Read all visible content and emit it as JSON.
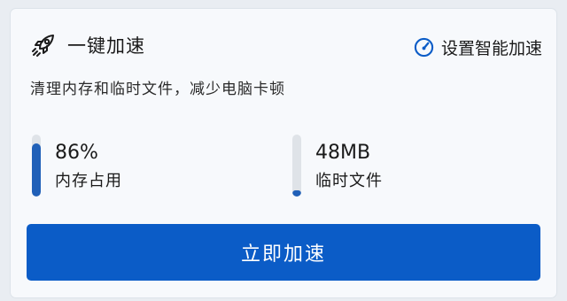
{
  "header": {
    "title": "一键加速",
    "icon": "rocket-icon",
    "settings_label": "设置智能加速",
    "settings_icon": "speedometer-icon"
  },
  "subtitle": "清理内存和临时文件，减少电脑卡顿",
  "metrics": [
    {
      "value": "86%",
      "label": "内存占用",
      "level": 0.86
    },
    {
      "value": "48MB",
      "label": "临时文件",
      "level": 0.1
    }
  ],
  "action_button": {
    "label": "立即加速"
  },
  "colors": {
    "accent": "#0b5cc7",
    "bar_fill": "#2060b8",
    "bar_track": "#dfe3e8"
  }
}
